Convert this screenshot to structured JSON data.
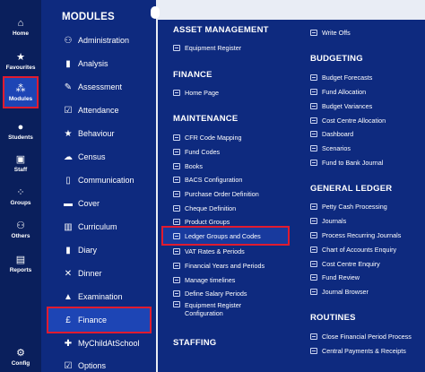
{
  "rail": [
    {
      "label": "Home",
      "icon": "home-icon",
      "glyph": "⌂"
    },
    {
      "label": "Favourites",
      "icon": "star-icon",
      "glyph": "★"
    },
    {
      "label": "Modules",
      "icon": "modules-icon",
      "glyph": "⁂"
    },
    {
      "label": "Students",
      "icon": "person-icon",
      "glyph": "●"
    },
    {
      "label": "Staff",
      "icon": "staff-icon",
      "glyph": "▣"
    },
    {
      "label": "Groups",
      "icon": "groups-icon",
      "glyph": "⁘"
    },
    {
      "label": "Others",
      "icon": "others-icon",
      "glyph": "⚇"
    },
    {
      "label": "Reports",
      "icon": "reports-icon",
      "glyph": "▤"
    },
    {
      "label": "Config",
      "icon": "gear-icon",
      "glyph": "⚙"
    }
  ],
  "modules": {
    "title": "MODULES",
    "items": [
      {
        "label": "Administration",
        "icon": "administration-icon",
        "glyph": "⚇"
      },
      {
        "label": "Analysis",
        "icon": "bar-chart-icon",
        "glyph": "▮"
      },
      {
        "label": "Assessment",
        "icon": "pen-icon",
        "glyph": "✎"
      },
      {
        "label": "Attendance",
        "icon": "checklist-icon",
        "glyph": "☑"
      },
      {
        "label": "Behaviour",
        "icon": "star-icon",
        "glyph": "★"
      },
      {
        "label": "Census",
        "icon": "cloud-upload-icon",
        "glyph": "☁"
      },
      {
        "label": "Communication",
        "icon": "phone-icon",
        "glyph": "▯"
      },
      {
        "label": "Cover",
        "icon": "cover-icon",
        "glyph": "▬"
      },
      {
        "label": "Curriculum",
        "icon": "curriculum-icon",
        "glyph": "▥"
      },
      {
        "label": "Diary",
        "icon": "book-icon",
        "glyph": "▮"
      },
      {
        "label": "Dinner",
        "icon": "cutlery-icon",
        "glyph": "✕"
      },
      {
        "label": "Examination",
        "icon": "graduation-cap-icon",
        "glyph": "▲"
      },
      {
        "label": "Finance",
        "icon": "pound-icon",
        "glyph": "£"
      },
      {
        "label": "MyChildAtSchool",
        "icon": "child-icon",
        "glyph": "✚"
      },
      {
        "label": "Options",
        "icon": "options-icon",
        "glyph": "☑"
      }
    ]
  },
  "submenu": {
    "asset_management": {
      "title": "ASSET MANAGEMENT",
      "links": [
        "Equipment Register"
      ]
    },
    "finance": {
      "title": "FINANCE",
      "links": [
        "Home Page"
      ]
    },
    "maintenance": {
      "title": "MAINTENANCE",
      "links": [
        "CFR Code Mapping",
        "Fund Codes",
        "Books",
        "BACS Configuration",
        "Purchase Order Definition",
        "Cheque Definition",
        "Product Groups",
        "Ledger Groups and Codes",
        "VAT Rates & Periods",
        "Financial Years and Periods",
        "Manage timelines",
        "Define Salary Periods",
        "Equipment Register Configuration"
      ]
    },
    "staffing": {
      "title": "STAFFING"
    },
    "write_offs": "Write Offs",
    "budgeting": {
      "title": "BUDGETING",
      "links": [
        "Budget Forecasts",
        "Fund Allocation",
        "Budget Variances",
        "Cost Centre Allocation",
        "Dashboard",
        "Scenarios",
        "Fund to Bank Journal"
      ]
    },
    "general_ledger": {
      "title": "GENERAL LEDGER",
      "links": [
        "Petty Cash Processing",
        "Journals",
        "Process Recurring Journals",
        "Chart of Accounts Enquiry",
        "Cost Centre Enquiry",
        "Fund Review",
        "Journal Browser"
      ]
    },
    "routines": {
      "title": "ROUTINES",
      "links": [
        "Close Financial Period Process",
        "Central Payments & Receipts"
      ]
    }
  },
  "colors": {
    "rail_bg": "#0a1f5c",
    "panel_bg": "#0e2a7f",
    "highlight": "#1d45b5",
    "outline": "#e01b2f"
  }
}
